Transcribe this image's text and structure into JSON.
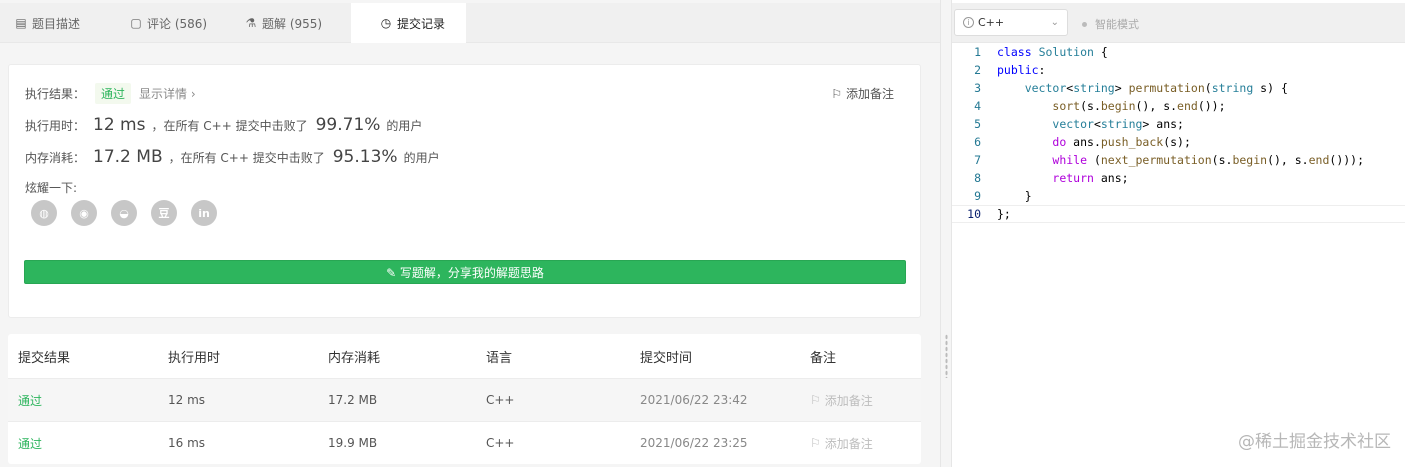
{
  "tabs": [
    {
      "icon": "description-icon",
      "glyph": "▤",
      "label": "题目描述"
    },
    {
      "icon": "comment-icon",
      "glyph": "▢",
      "label": "评论 (586)"
    },
    {
      "icon": "flask-icon",
      "glyph": "⚗",
      "label": "题解 (955)"
    },
    {
      "icon": "clock-icon",
      "glyph": "◷",
      "label": "提交记录",
      "active": true
    }
  ],
  "result": {
    "exec_label": "执行结果：",
    "status": "通过",
    "detail_link": "显示详情 ›",
    "add_note": "添加备注",
    "time_label": "执行用时：",
    "time_value": "12 ms",
    "time_desc": "，在所有 C++ 提交中击败了",
    "time_percent": "99.71%",
    "time_suffix": "的用户",
    "mem_label": "内存消耗：",
    "mem_value": "17.2 MB",
    "mem_desc": "，在所有 C++ 提交中击败了",
    "mem_percent": "95.13%",
    "mem_suffix": "的用户",
    "share_label": "炫耀一下:",
    "share_icons": [
      {
        "name": "wechat-icon",
        "glyph": "◍"
      },
      {
        "name": "weibo-icon",
        "glyph": "◉"
      },
      {
        "name": "qq-icon",
        "glyph": "◒"
      },
      {
        "name": "douban-icon",
        "glyph": "豆"
      },
      {
        "name": "linkedin-icon",
        "glyph": "in"
      }
    ],
    "write_button": "✎ 写题解，分享我的解题思路"
  },
  "submissions": {
    "headers": [
      "提交结果",
      "执行用时",
      "内存消耗",
      "语言",
      "提交时间",
      "备注"
    ],
    "rows": [
      {
        "status": "通过",
        "time": "12 ms",
        "memory": "17.2 MB",
        "lang": "C++",
        "submitted": "2021/06/22 23:42",
        "note": "添加备注"
      },
      {
        "status": "通过",
        "time": "16 ms",
        "memory": "19.9 MB",
        "lang": "C++",
        "submitted": "2021/06/22 23:25",
        "note": "添加备注"
      }
    ]
  },
  "editor": {
    "language": "C++",
    "smart_mode": "智能模式",
    "lines": [
      "1",
      "2",
      "3",
      "4",
      "5",
      "6",
      "7",
      "8",
      "9",
      "10"
    ]
  },
  "watermark": "@稀土掘金技术社区"
}
